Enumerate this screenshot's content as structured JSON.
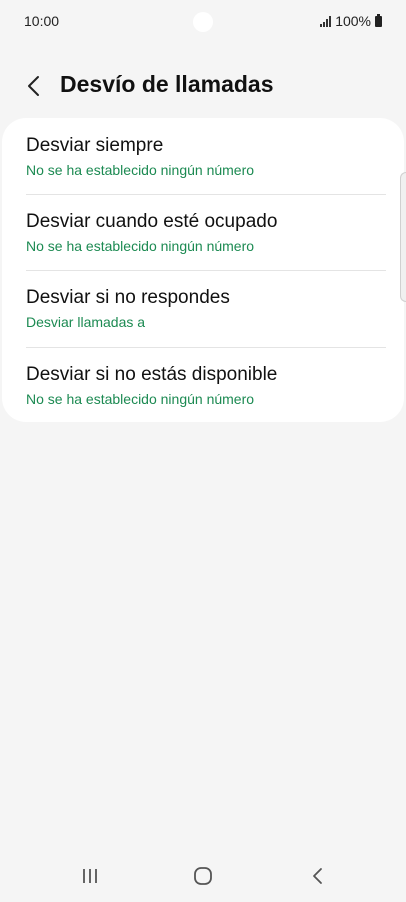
{
  "status_bar": {
    "time": "10:00",
    "battery": "100%",
    "icons": [
      "signal-icon",
      "battery-icon"
    ]
  },
  "header": {
    "back_icon": "chevron-left-icon",
    "title": "Desvío de llamadas"
  },
  "menu": {
    "items": [
      {
        "title": "Desviar siempre",
        "subtitle": "No se ha establecido ningún número"
      },
      {
        "title": "Desviar cuando esté ocupado",
        "subtitle": "No se ha establecido ningún número"
      },
      {
        "title": "Desviar si no respondes",
        "subtitle": "Desviar llamadas a"
      },
      {
        "title": "Desviar si no estás disponible",
        "subtitle": "No se ha establecido ningún número"
      }
    ]
  },
  "nav_bar": {
    "icons": [
      "recent-apps-icon",
      "home-icon",
      "back-icon"
    ]
  },
  "colors": {
    "accent_green": "#1c8a52",
    "background": "#f5f5f5",
    "card": "#ffffff"
  }
}
